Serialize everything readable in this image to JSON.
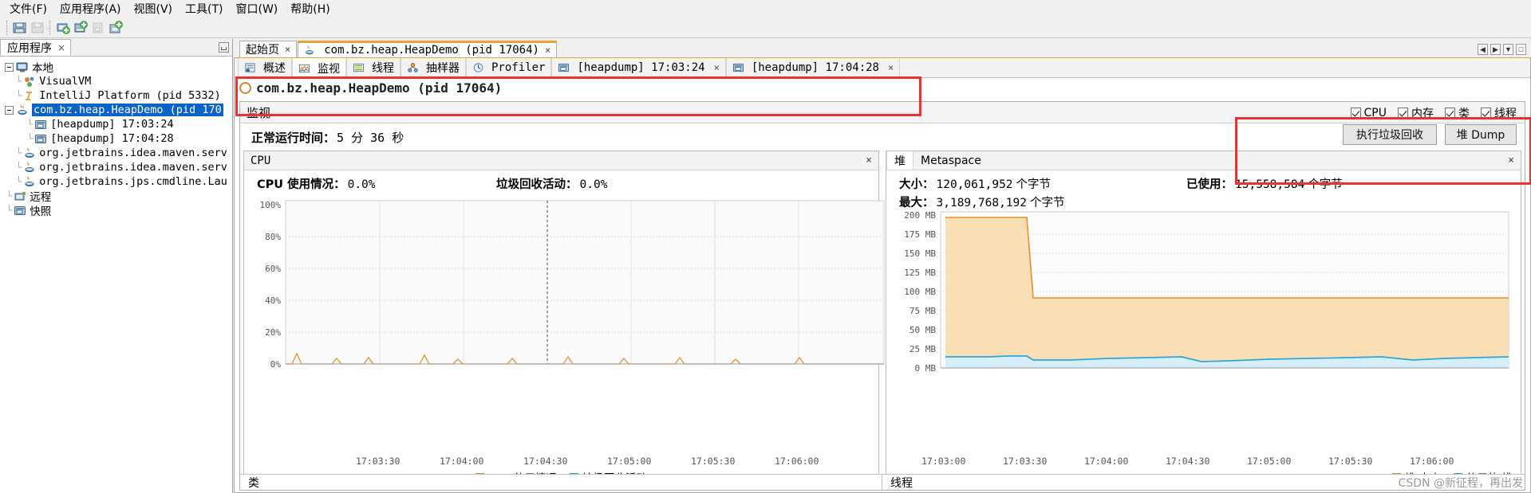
{
  "menubar": {
    "items": [
      {
        "label": "文件(F)",
        "mnemonic": "F"
      },
      {
        "label": "应用程序(A)",
        "mnemonic": "A"
      },
      {
        "label": "视图(V)",
        "mnemonic": "V"
      },
      {
        "label": "工具(T)",
        "mnemonic": "T"
      },
      {
        "label": "窗口(W)",
        "mnemonic": "W"
      },
      {
        "label": "帮助(H)",
        "mnemonic": "H"
      }
    ]
  },
  "toolbar": {
    "icons": [
      "open-folder-icon",
      "save-icon",
      "add-remote-host-icon",
      "add-jmx-connection-icon",
      "snapshot-icon",
      "add-application-icon"
    ]
  },
  "left_panel": {
    "tab_label": "应用程序",
    "tab_close": "×",
    "minimize_icon": "minimize-icon",
    "tree": [
      {
        "label": "本地",
        "icon": "computer-icon",
        "depth": 0,
        "expanded": true,
        "selected": false
      },
      {
        "label": "VisualVM",
        "icon": "visualvm-icon",
        "depth": 1,
        "selected": false
      },
      {
        "label": "IntelliJ Platform (pid 5332)",
        "icon": "intellij-icon",
        "depth": 1,
        "selected": false
      },
      {
        "label": "com.bz.heap.HeapDemo (pid 170",
        "icon": "java-icon",
        "depth": 1,
        "expanded": true,
        "selected": true
      },
      {
        "label": "[heapdump] 17:03:24",
        "icon": "heapdump-icon",
        "depth": 2,
        "selected": false
      },
      {
        "label": "[heapdump] 17:04:28",
        "icon": "heapdump-icon",
        "depth": 2,
        "selected": false
      },
      {
        "label": "org.jetbrains.idea.maven.serv",
        "icon": "java-icon",
        "depth": 1,
        "selected": false
      },
      {
        "label": "org.jetbrains.idea.maven.serv",
        "icon": "java-icon",
        "depth": 1,
        "selected": false
      },
      {
        "label": "org.jetbrains.jps.cmdline.Lau",
        "icon": "java-icon",
        "depth": 1,
        "selected": false
      },
      {
        "label": "远程",
        "icon": "remote-icon",
        "depth": 0,
        "selected": false
      },
      {
        "label": "快照",
        "icon": "snapshots-icon",
        "depth": 0,
        "selected": false
      }
    ]
  },
  "document_tabs": [
    {
      "label": "起始页",
      "icon": null,
      "active": false,
      "close": "×"
    },
    {
      "label": "com.bz.heap.HeapDemo (pid 17064)",
      "icon": "java-icon",
      "active": true,
      "close": "×"
    }
  ],
  "window_buttons": [
    "◀",
    "▶",
    "▼",
    "□"
  ],
  "sub_tabs": [
    {
      "label": "概述",
      "icon": "overview-icon",
      "active": false
    },
    {
      "label": "监视",
      "icon": "monitor-icon",
      "active": true
    },
    {
      "label": "线程",
      "icon": "threads-icon",
      "active": false
    },
    {
      "label": "抽样器",
      "icon": "sampler-icon",
      "active": false
    },
    {
      "label": "Profiler",
      "icon": "profiler-icon",
      "active": false
    },
    {
      "label": "[heapdump] 17:03:24",
      "icon": "heapdump-icon",
      "active": false,
      "close": "×"
    },
    {
      "label": "[heapdump] 17:04:28",
      "icon": "heapdump-icon",
      "active": false,
      "close": "×"
    }
  ],
  "document_title": "com.bz.heap.HeapDemo (pid 17064)",
  "monitor_panel": {
    "title": "监视",
    "checkboxes": [
      {
        "label": "CPU",
        "checked": true
      },
      {
        "label": "内存",
        "checked": true
      },
      {
        "label": "类",
        "checked": true
      },
      {
        "label": "线程",
        "checked": true
      }
    ],
    "uptime_label": "正常运行时间：",
    "uptime_value": "5 分 36 秒",
    "buttons": [
      {
        "label": "执行垃圾回收",
        "name": "perform-gc-button"
      },
      {
        "label": "堆 Dump",
        "name": "heap-dump-button"
      }
    ]
  },
  "cpu_card": {
    "title": "CPU",
    "close": "×",
    "stats": [
      {
        "key": "CPU 使用情况：",
        "value": "0.0%"
      },
      {
        "key": "垃圾回收活动：",
        "value": "0.0%"
      }
    ]
  },
  "heap_card": {
    "tabs": [
      {
        "label": "堆",
        "active": true
      },
      {
        "label": "Metaspace",
        "active": false
      }
    ],
    "close": "×",
    "stats": [
      {
        "key": "大小：",
        "value": "120,061,952",
        "unit": "个字节"
      },
      {
        "key": "已使用：",
        "value": "15,558,584",
        "unit": "个字节"
      },
      {
        "key": "最大：",
        "value": "3,189,768,192",
        "unit": "个字节"
      }
    ]
  },
  "bottom_strip": [
    {
      "label": "类"
    },
    {
      "label": "线程"
    }
  ],
  "watermark": "CSDN @新征程，再出发",
  "colors": {
    "cpu_series": "#e8912a",
    "gc_series": "#1f9fd0",
    "heap_size_fill": "#fbddb0",
    "heap_size_line": "#e8912a",
    "heap_used_fill": "#d6eefa",
    "heap_used_line": "#2aa6d8",
    "highlight": "#f03030",
    "selection": "#0a64c8",
    "tab_accent": "#f0a030"
  },
  "chart_data": [
    {
      "type": "line",
      "title": "CPU",
      "xlabel": "",
      "ylabel": "",
      "ylim": [
        0,
        100
      ],
      "yticks": [
        "0%",
        "20%",
        "40%",
        "60%",
        "80%",
        "100%"
      ],
      "xticks": [
        "17:03:30",
        "17:04:00",
        "17:04:30",
        "17:05:00",
        "17:05:30",
        "17:06:00"
      ],
      "grid": true,
      "legend_position": "bottom",
      "series": [
        {
          "name": "CPU 使用情况",
          "color": "#e8912a",
          "values": [
            0,
            0,
            4,
            1,
            0,
            0,
            0,
            2,
            1,
            0,
            0,
            0,
            0,
            0,
            3,
            1,
            0,
            0,
            0,
            0,
            0,
            2,
            0,
            0,
            0,
            0,
            1.5,
            0,
            0,
            0,
            0,
            0,
            2,
            0,
            0,
            0,
            0,
            0,
            0,
            0
          ]
        },
        {
          "name": "垃圾回收活动",
          "color": "#1f9fd0",
          "values": [
            0,
            0,
            0,
            0,
            0,
            0,
            0,
            0,
            0,
            0,
            0,
            0,
            0,
            0,
            0,
            0,
            0,
            0,
            0,
            0,
            0,
            0,
            0,
            0,
            0,
            0,
            0,
            0,
            0,
            0,
            0,
            0,
            0,
            0,
            0,
            0,
            0,
            0,
            0,
            0
          ]
        }
      ],
      "annotations": [
        {
          "type": "vertical-line",
          "x_label": "17:04:28",
          "style": "dotted"
        }
      ]
    },
    {
      "type": "area",
      "title": "堆",
      "xlabel": "",
      "ylabel": "",
      "ylim": [
        0,
        200
      ],
      "yticks": [
        "0 MB",
        "25 MB",
        "50 MB",
        "75 MB",
        "100 MB",
        "125 MB",
        "150 MB",
        "175 MB",
        "200 MB"
      ],
      "xticks": [
        "17:03:00",
        "17:03:30",
        "17:04:00",
        "17:04:30",
        "17:05:00",
        "17:05:30",
        "17:06:00"
      ],
      "grid": true,
      "legend_position": "bottom-right",
      "series": [
        {
          "name": "堆 大小",
          "color": "#e8912a",
          "fill": "#fbddb0",
          "values": [
            193,
            193,
            193,
            193,
            193,
            193,
            193,
            193,
            193,
            114,
            114,
            114,
            114,
            114,
            114,
            114,
            114,
            114,
            114,
            114,
            114,
            114,
            114,
            114,
            114,
            114,
            114,
            114,
            114,
            114,
            114,
            114,
            114,
            114,
            114,
            114,
            114,
            114,
            114,
            114
          ]
        },
        {
          "name": "使用的 堆",
          "color": "#2aa6d8",
          "fill": "#d6eefa",
          "values": [
            18,
            18,
            18,
            18,
            18,
            18,
            18,
            18,
            18,
            14,
            14,
            14,
            14,
            14,
            15,
            15,
            15,
            15,
            15,
            16,
            16,
            16,
            17,
            13,
            13,
            14,
            14,
            14,
            15,
            15,
            15,
            16,
            16,
            16,
            17,
            17,
            15,
            15,
            16,
            16
          ]
        }
      ]
    }
  ]
}
